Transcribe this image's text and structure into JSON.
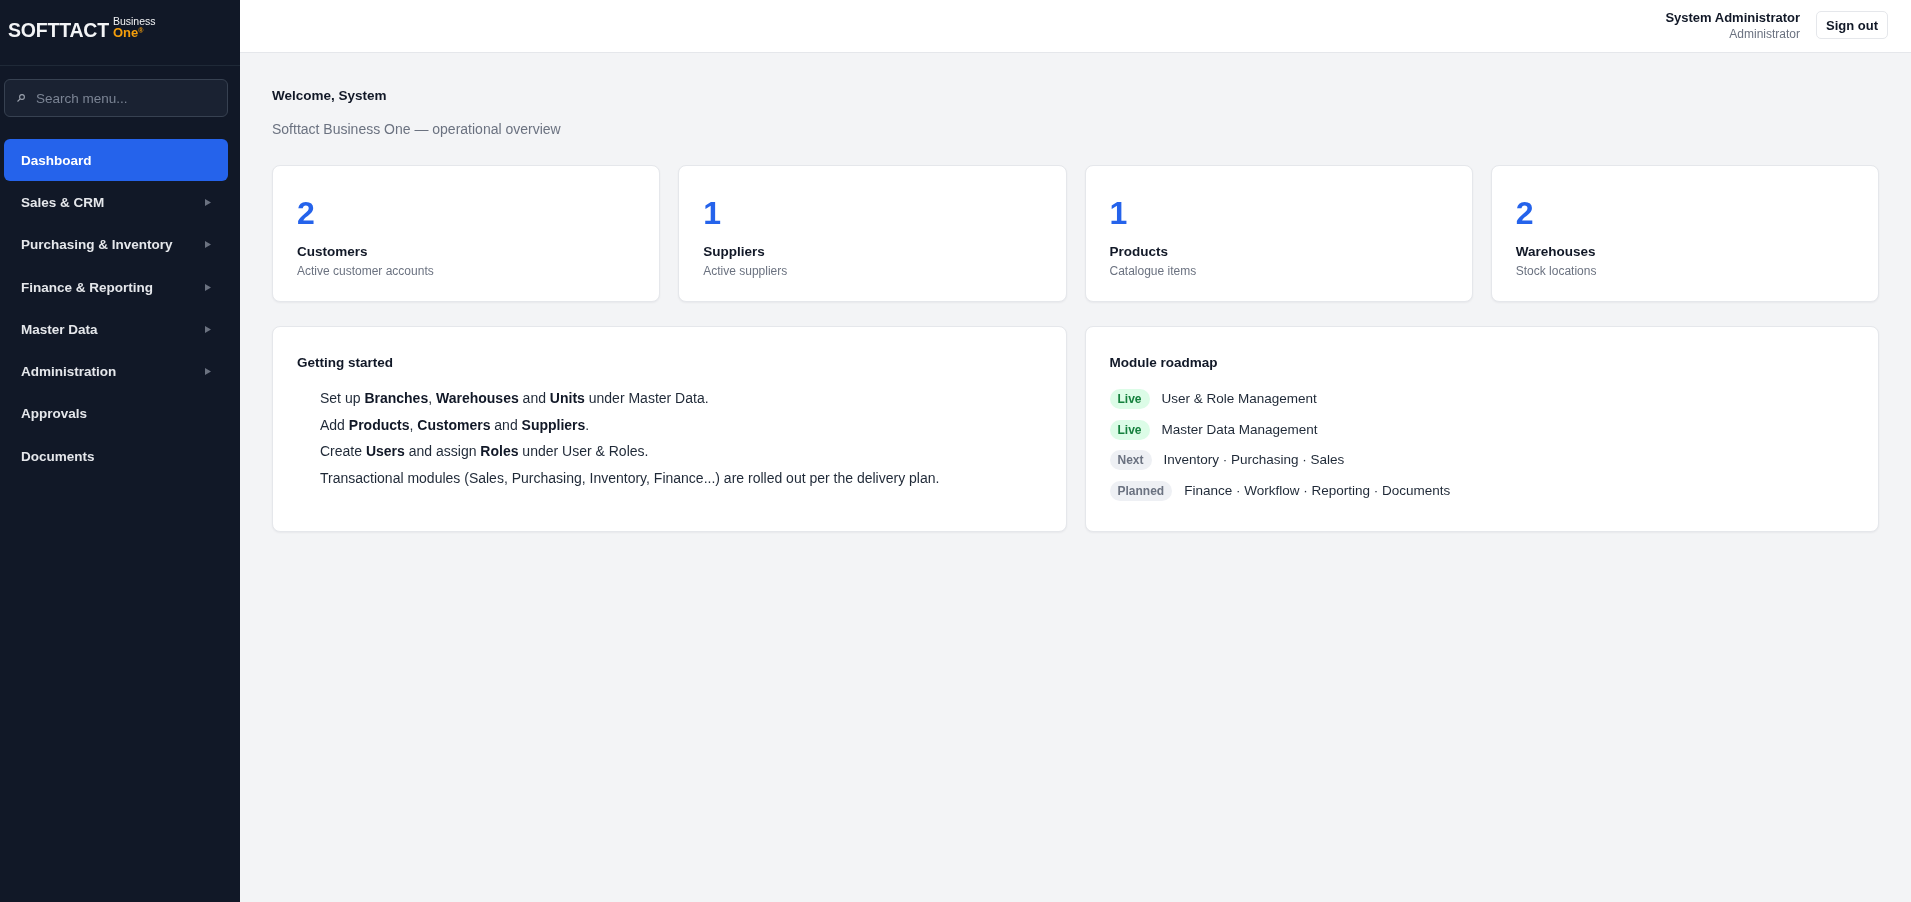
{
  "sidebar": {
    "logo": {
      "wordmark": "SOFTTACT",
      "tagline": "Business",
      "product": "One$^{®}$"
    },
    "search": {
      "placeholder": "Search menu..."
    },
    "items": [
      {
        "label": "Dashboard",
        "kind": "link",
        "selected": true
      },
      {
        "label": "Sales & CRM",
        "kind": "group",
        "selected": false
      },
      {
        "label": "Purchasing & Inventory",
        "kind": "group",
        "selected": false
      },
      {
        "label": "Finance & Reporting",
        "kind": "group",
        "selected": false
      },
      {
        "label": "Master Data",
        "kind": "group",
        "selected": false
      },
      {
        "label": "Administration",
        "kind": "group",
        "selected": false
      },
      {
        "label": "Approvals",
        "kind": "link",
        "selected": false
      },
      {
        "label": "Documents",
        "kind": "link",
        "selected": false
      }
    ]
  },
  "header": {
    "user": {
      "name": "System Administrator",
      "role": "Administrator"
    },
    "sign_out_button": "Sign out"
  },
  "welcome": {
    "title": "Welcome, System",
    "subtitle": "Softtact Business One — operational overview"
  },
  "stats": [
    {
      "value": "2",
      "label": "Customers",
      "caption": "Active customer accounts"
    },
    {
      "value": "1",
      "label": "Suppliers",
      "caption": "Active suppliers"
    },
    {
      "value": "1",
      "label": "Products",
      "caption": "Catalogue items"
    },
    {
      "value": "2",
      "label": "Warehouses",
      "caption": "Stock locations"
    }
  ],
  "getting_started": {
    "title": "Getting started",
    "steps": [
      "Set up **Branches**, **Warehouses** and **Units** under Master Data.",
      "Add **Products**, **Customers** and **Suppliers**.",
      "Create **Users** and assign **Roles** under User & Roles.",
      "Transactional modules (Sales, Purchasing, Inventory, Finance...) are rolled out per the delivery plan."
    ]
  },
  "roadmap": {
    "title": "Module roadmap",
    "items": [
      {
        "badge": "Live",
        "kind": "live",
        "text": "User & Role Management"
      },
      {
        "badge": "Live",
        "kind": "live",
        "text": "Master Data Management"
      },
      {
        "badge": "Next",
        "kind": "next",
        "text": "Inventory · Purchasing · Sales"
      },
      {
        "badge": "Planned",
        "kind": "planned",
        "text": "Finance · Workflow · Reporting · Documents"
      }
    ]
  }
}
